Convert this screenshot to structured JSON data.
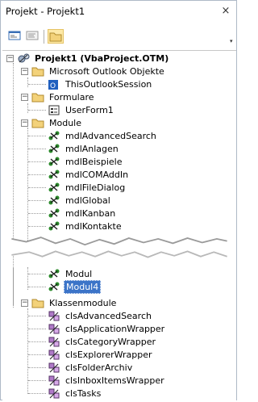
{
  "window": {
    "title": "Projekt - Projekt1",
    "close_glyph": "×"
  },
  "toolbar": {
    "view_object_icon": "view-object-icon",
    "view_code_icon": "view-code-icon",
    "toggle_folders_icon": "folder-icon",
    "more_glyph": "▾"
  },
  "tree": {
    "project": {
      "label": "Projekt1 (VbaProject.OTM)",
      "icon": "vba-project-icon"
    },
    "groups": [
      {
        "label": "Microsoft Outlook Objekte",
        "items": [
          "ThisOutlookSession"
        ]
      },
      {
        "label": "Formulare",
        "items": [
          "UserForm1"
        ]
      },
      {
        "label": "Module",
        "items_top": [
          "mdlAdvancedSearch",
          "mdlAnlagen",
          "mdlBeispiele",
          "mdlCOMAddIn",
          "mdlFileDialog",
          "mdlGlobal",
          "mdlKanban",
          "mdlKontakte"
        ],
        "items_bottom": [
          "Modul",
          "Modul4"
        ],
        "selected": "Modul4"
      },
      {
        "label": "Klassenmodule",
        "items": [
          "clsAdvancedSearch",
          "clsApplicationWrapper",
          "clsCategoryWrapper",
          "clsExplorerWrapper",
          "clsFolderArchiv",
          "clsInboxItemsWrapper",
          "clsTasks"
        ]
      }
    ]
  },
  "colors": {
    "selection": "#3c74c8",
    "folder": "#f3d27a",
    "border": "#aeb9c7"
  }
}
